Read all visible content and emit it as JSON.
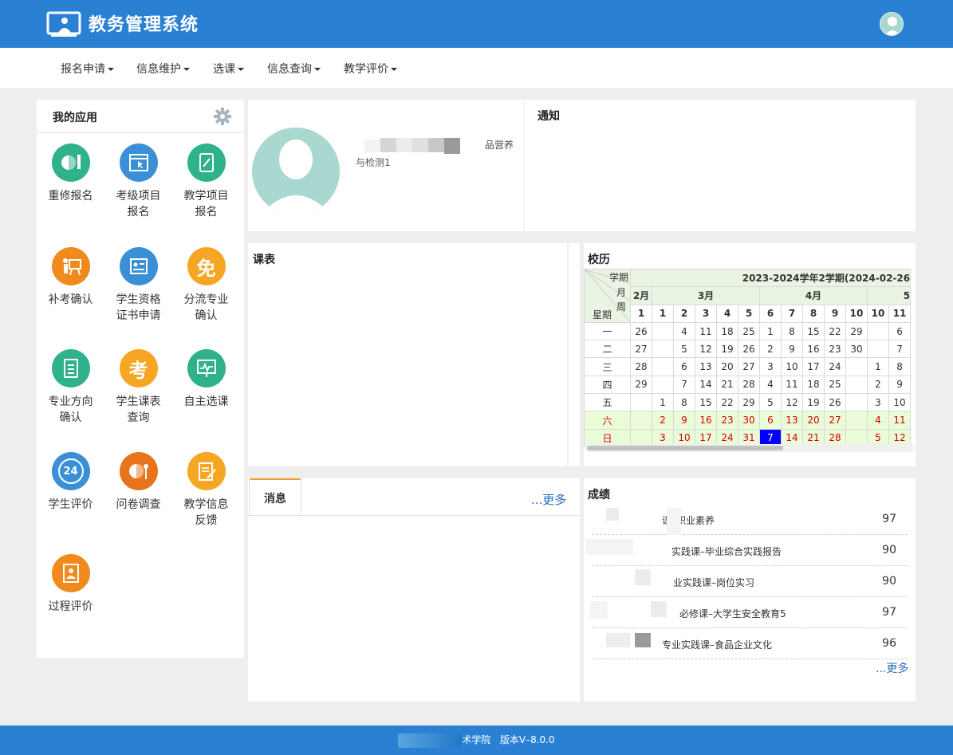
{
  "header": {
    "title": "教务管理系统"
  },
  "nav": [
    "报名申请",
    "信息维护",
    "选课",
    "信息查询",
    "教学评价"
  ],
  "apps": {
    "title": "我的应用",
    "items": [
      {
        "label": "重修报名",
        "color": "#2fb18b",
        "icon": "pie-pencil-icon"
      },
      {
        "label": "考级项目报名",
        "color": "#3a8fd6",
        "icon": "window-cursor-icon"
      },
      {
        "label": "教学项目报名",
        "color": "#2fb18b",
        "icon": "book-pen-icon"
      },
      {
        "label": "补考确认",
        "color": "#f08a1c",
        "icon": "teacher-board-icon"
      },
      {
        "label": "学生资格证书申请",
        "color": "#3a8fd6",
        "icon": "certificate-icon"
      },
      {
        "label": "分流专业确认",
        "color": "#f5a623",
        "icon": "mian-character-icon",
        "glyph": "免"
      },
      {
        "label": "专业方向确认",
        "color": "#2fb18b",
        "icon": "document-list-icon"
      },
      {
        "label": "学生课表查询",
        "color": "#f5a623",
        "icon": "clipboard-exam-icon",
        "glyph": "考"
      },
      {
        "label": "自主选课",
        "color": "#2fb18b",
        "icon": "monitor-chart-icon"
      },
      {
        "label": "学生评价",
        "color": "#3a8fd6",
        "icon": "clock-24-icon",
        "glyph": "24"
      },
      {
        "label": "问卷调查",
        "color": "#e8731c",
        "icon": "pie-key-icon"
      },
      {
        "label": "教学信息反馈",
        "color": "#f5a623",
        "icon": "notepad-pen-icon"
      },
      {
        "label": "过程评价",
        "color": "#f08a1c",
        "icon": "user-document-icon"
      }
    ]
  },
  "profile": {
    "major_line1": "品营养",
    "major_line2": "与检测1"
  },
  "notice": {
    "title": "通知"
  },
  "schedule": {
    "title": "课表"
  },
  "calendar": {
    "title": "校历",
    "corner_term": "学期",
    "corner_month": "月",
    "corner_week": "周",
    "corner_weekday": "星期",
    "term": "2023-2024学年2学期(2024-02-26",
    "months": [
      "2月",
      "3月",
      "4月",
      "5"
    ],
    "weeks": [
      "1",
      "1",
      "2",
      "3",
      "4",
      "5",
      "6",
      "7",
      "8",
      "9",
      "10",
      "10",
      "11"
    ],
    "rows": [
      {
        "day": "一",
        "cells": [
          "26",
          "",
          "4",
          "11",
          "18",
          "25",
          "1",
          "8",
          "15",
          "22",
          "29",
          "",
          "6"
        ]
      },
      {
        "day": "二",
        "cells": [
          "27",
          "",
          "5",
          "12",
          "19",
          "26",
          "2",
          "9",
          "16",
          "23",
          "30",
          "",
          "7"
        ]
      },
      {
        "day": "三",
        "cells": [
          "28",
          "",
          "6",
          "13",
          "20",
          "27",
          "3",
          "10",
          "17",
          "24",
          "",
          "1",
          "8"
        ]
      },
      {
        "day": "四",
        "cells": [
          "29",
          "",
          "7",
          "14",
          "21",
          "28",
          "4",
          "11",
          "18",
          "25",
          "",
          "2",
          "9"
        ]
      },
      {
        "day": "五",
        "cells": [
          "",
          "1",
          "8",
          "15",
          "22",
          "29",
          "5",
          "12",
          "19",
          "26",
          "",
          "3",
          "10"
        ]
      },
      {
        "day": "六",
        "cells": [
          "",
          "2",
          "9",
          "16",
          "23",
          "30",
          "6",
          "13",
          "20",
          "27",
          "",
          "4",
          "11"
        ]
      },
      {
        "day": "日",
        "cells": [
          "",
          "3",
          "10",
          "17",
          "24",
          "31",
          "7",
          "14",
          "21",
          "28",
          "",
          "5",
          "12"
        ]
      }
    ]
  },
  "messages": {
    "tab": "消息",
    "more": "...更多"
  },
  "grades": {
    "title": "成绩",
    "more": "...更多",
    "rows": [
      {
        "course": "课–职业素养",
        "score": "97"
      },
      {
        "course": "实践课–毕业综合实践报告",
        "score": "90"
      },
      {
        "course": "业实践课–岗位实习",
        "score": "90"
      },
      {
        "course": "必修课–大学生安全教育5",
        "score": "97"
      },
      {
        "course": "专业实践课–食品企业文化",
        "score": "96"
      }
    ]
  },
  "footer": {
    "school": "术学院",
    "version": "版本V–8.0.0"
  }
}
